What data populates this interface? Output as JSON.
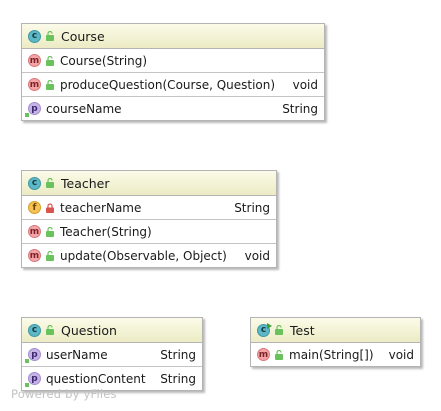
{
  "classes": {
    "course": {
      "name": "Course",
      "members": [
        {
          "kind": "m",
          "name": "Course(String)",
          "type": ""
        },
        {
          "kind": "m",
          "name": "produceQuestion(Course, Question)",
          "type": "void"
        },
        {
          "kind": "p",
          "name": "courseName",
          "type": "String"
        }
      ]
    },
    "teacher": {
      "name": "Teacher",
      "members": [
        {
          "kind": "f",
          "name": "teacherName",
          "type": "String"
        },
        {
          "kind": "m",
          "name": "Teacher(String)",
          "type": ""
        },
        {
          "kind": "m",
          "name": "update(Observable, Object)",
          "type": "void"
        }
      ]
    },
    "question": {
      "name": "Question",
      "members": [
        {
          "kind": "p",
          "name": "userName",
          "type": "String"
        },
        {
          "kind": "p",
          "name": "questionContent",
          "type": "String"
        }
      ]
    },
    "test": {
      "name": "Test",
      "members": [
        {
          "kind": "m",
          "name": "main(String[])",
          "type": "void"
        }
      ]
    }
  },
  "badges": {
    "class": "c",
    "method": "m",
    "property": "p",
    "field": "f"
  },
  "watermark": "Powered by yFiles",
  "colors": {
    "header_top": "#fbfbe9",
    "header_bottom": "#ecebc4",
    "border": "#b4b4b4",
    "class_badge": "#5cb8c6",
    "method_badge": "#f4a3a6",
    "property_badge": "#c5b2e6",
    "field_badge": "#f6c253",
    "public_icon": "#6ac25c",
    "private_icon": "#d9534f"
  }
}
